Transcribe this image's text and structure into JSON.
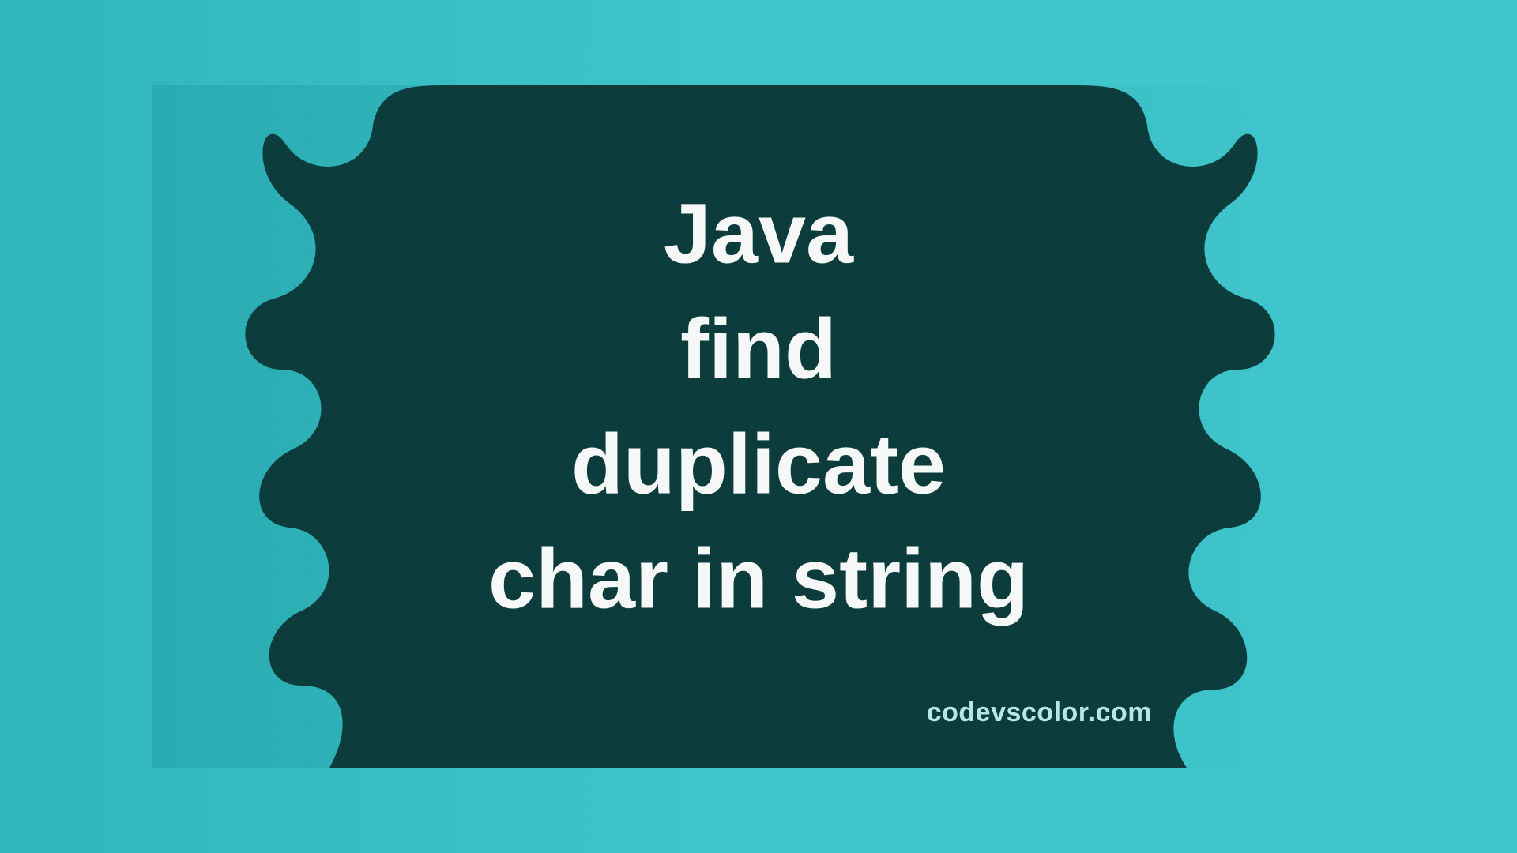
{
  "title": {
    "line1": "Java",
    "line2": "find",
    "line3": "duplicate",
    "line4": "char in string"
  },
  "attribution": "codevscolor.com",
  "colors": {
    "bg_left": "#2aacb2",
    "bg_right": "#40c6cc",
    "blob": "#0d3c3c",
    "text": "#f5f8f6",
    "attribution": "#b7e6e8"
  }
}
